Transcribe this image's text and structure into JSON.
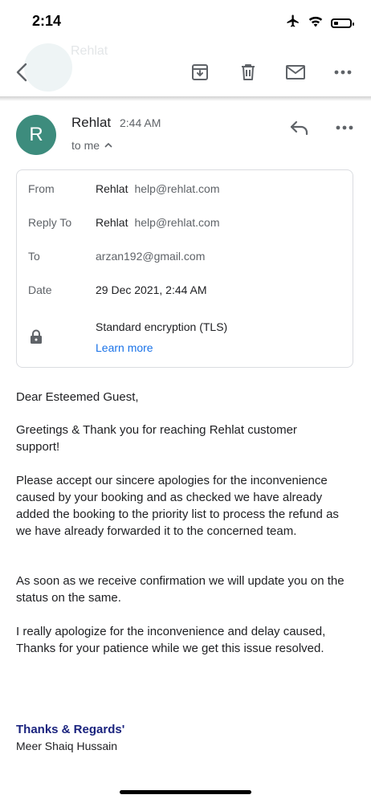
{
  "status_bar": {
    "time": "2:14",
    "icons": [
      "airplane-icon",
      "wifi-icon",
      "battery-icon"
    ],
    "battery_level": 0.3
  },
  "ghost": {
    "text": "Rehlat"
  },
  "toolbar": {
    "icons": [
      "back-arrow-icon",
      "archive-icon",
      "trash-icon",
      "mail-icon",
      "more-horizontal-icon"
    ]
  },
  "sender": {
    "avatar_letter": "R",
    "avatar_color": "#3d8c7d",
    "name": "Rehlat",
    "time": "2:44 AM",
    "to_me": "to me"
  },
  "details": {
    "from": {
      "label": "From",
      "name": "Rehlat",
      "email": "help@rehlat.com"
    },
    "reply_to": {
      "label": "Reply To",
      "name": "Rehlat",
      "email": "help@rehlat.com"
    },
    "to": {
      "label": "To",
      "value": "arzan192@gmail.com"
    },
    "date": {
      "label": "Date",
      "value": "29 Dec 2021, 2:44 AM"
    },
    "encryption": {
      "text": "Standard encryption (TLS)",
      "link": "Learn more"
    }
  },
  "body": {
    "greeting": "Dear Esteemed Guest,",
    "p1": "Greetings & Thank you for reaching Rehlat customer support!",
    "p2": "Please accept our sincere apologies for the inconvenience caused by your booking and as checked we have already added the booking to the priority list to process the refund as we have already forwarded it to the concerned team.",
    "p3": "As soon as we receive confirmation we will update you on the status on the same.",
    "p4": "I really apologize for the inconvenience and delay caused, Thanks for your patience while we get this issue resolved."
  },
  "signature": {
    "line1": "Thanks & Regards'",
    "line2": "Meer Shaiq Hussain"
  },
  "colors": {
    "link": "#1a73e8",
    "signature": "#1a237e",
    "avatar": "#3d8c7d"
  }
}
